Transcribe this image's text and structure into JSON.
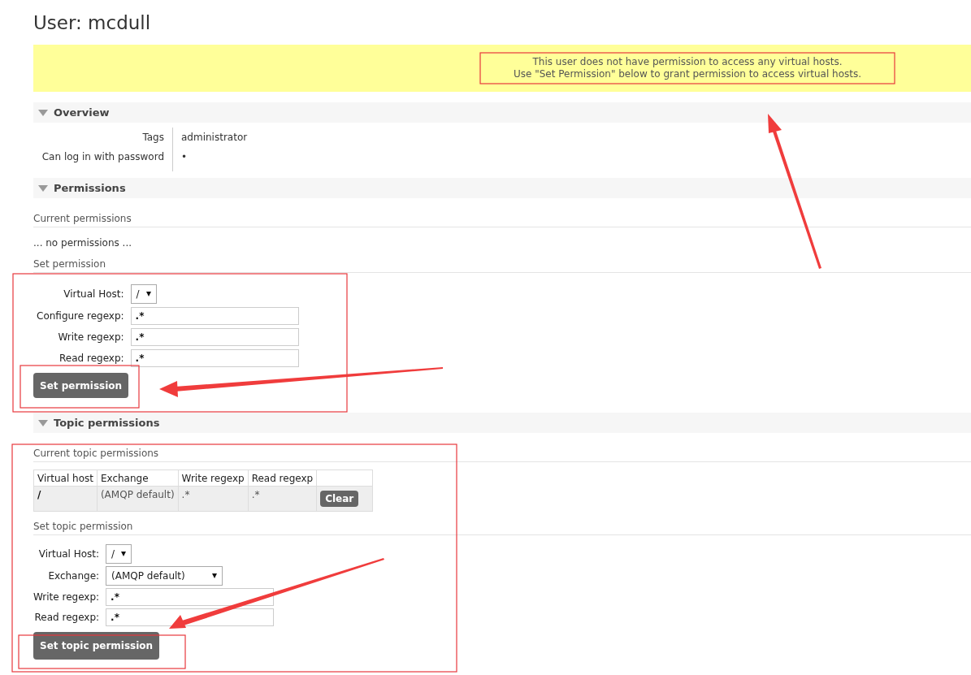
{
  "page_title": "User: mcdull",
  "notice": [
    "This user does not have permission to access any virtual hosts.",
    "Use \"Set Permission\" below to grant permission to access virtual hosts."
  ],
  "overview": {
    "title": "Overview",
    "rows": [
      {
        "label": "Tags",
        "value": "administrator"
      },
      {
        "label": "Can log in with password",
        "value": "•"
      }
    ]
  },
  "permissions": {
    "title": "Permissions",
    "current_heading": "Current permissions",
    "empty_text": "... no permissions ...",
    "set_heading": "Set permission",
    "fields": [
      {
        "kind": "select",
        "label": "Virtual Host:",
        "value": "/"
      },
      {
        "kind": "input",
        "label": "Configure regexp:",
        "value": ".*"
      },
      {
        "kind": "input",
        "label": "Write regexp:",
        "value": ".*"
      },
      {
        "kind": "input",
        "label": "Read regexp:",
        "value": ".*"
      }
    ],
    "button": "Set permission"
  },
  "topic_permissions": {
    "title": "Topic permissions",
    "current_heading": "Current topic permissions",
    "table": {
      "columns": [
        "Virtual host",
        "Exchange",
        "Write regexp",
        "Read regexp"
      ],
      "rows": [
        {
          "cells": [
            "/",
            "(AMQP default)",
            ".*",
            ".*"
          ],
          "action": "Clear"
        }
      ]
    },
    "set_heading": "Set topic permission",
    "fields": [
      {
        "kind": "select",
        "label": "Virtual Host:",
        "value": "/"
      },
      {
        "kind": "wide_select",
        "label": "Exchange:",
        "value": "(AMQP default)"
      },
      {
        "kind": "input",
        "label": "Write regexp:",
        "value": ".*"
      },
      {
        "kind": "input",
        "label": "Read regexp:",
        "value": ".*"
      }
    ],
    "button": "Set topic permission"
  }
}
